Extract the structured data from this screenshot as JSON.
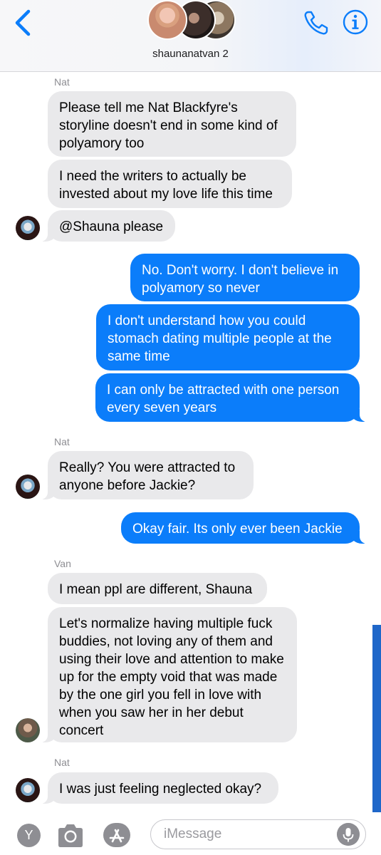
{
  "header": {
    "group_name": "shaunanatvan 2",
    "icons": {
      "back": "chevron-left-icon",
      "phone": "phone-icon",
      "info": "info-icon"
    },
    "accent": "#0b7dfa"
  },
  "messages": [
    {
      "sender": "Nat",
      "text": "Please tell me Nat Blackfyre's storyline doesn't end in some kind of polyamory too"
    },
    {
      "text": "I need the writers to actually be invested about my love life this time"
    },
    {
      "text": "@Shauna please"
    },
    {
      "text": "No. Don't worry. I don't believe in polyamory so never"
    },
    {
      "text": "I don't understand how you could stomach dating multiple people at the same time"
    },
    {
      "text": "I can only be attracted with one person every seven years"
    },
    {
      "sender": "Nat",
      "text": "Really? You were attracted to anyone before Jackie?"
    },
    {
      "text": "Okay fair. Its only ever been Jackie"
    },
    {
      "sender": "Van",
      "text": "I mean ppl are different, Shauna"
    },
    {
      "text": "Let's normalize having multiple fuck buddies, not loving any of them and using their love and attention to make up for the empty void that was made by the one girl you fell in love with when you saw her in her debut concert"
    },
    {
      "sender": "Nat",
      "text": "I was just feeling neglected okay?"
    }
  ],
  "colors": {
    "incoming": "#e9e9eb",
    "outgoing": "#0b7dfa"
  },
  "compose": {
    "apps_letter": "Y",
    "placeholder": "iMessage",
    "icons": {
      "camera": "camera-icon",
      "appstore": "app-store-icon",
      "mic": "microphone-icon"
    }
  }
}
